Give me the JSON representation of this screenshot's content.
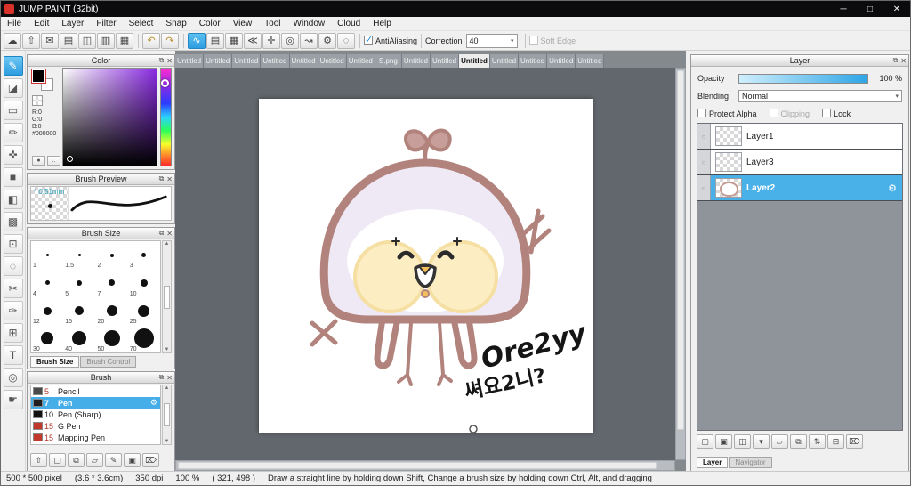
{
  "window": {
    "title": "JUMP PAINT (32bit)",
    "controls": {
      "minimize": "─",
      "maximize": "□",
      "close": "✕"
    }
  },
  "menu": {
    "items": [
      "File",
      "Edit",
      "Layer",
      "Filter",
      "Select",
      "Snap",
      "Color",
      "View",
      "Tool",
      "Window",
      "Cloud",
      "Help"
    ]
  },
  "panel_icons": {
    "popout": "⧉",
    "close": "✕",
    "gear": "⚙",
    "up": "▲",
    "down": "▼",
    "dropdown": "▾",
    "circle": "○",
    "eye": "●",
    "more": ".."
  },
  "toolbar": {
    "icons": [
      {
        "name": "cloud-icon",
        "glyph": "☁"
      },
      {
        "name": "upload-icon",
        "glyph": "⇧"
      },
      {
        "name": "comment-icon",
        "glyph": "✉"
      },
      {
        "name": "display-icon",
        "glyph": "▤"
      },
      {
        "name": "pages-icon",
        "glyph": "◫"
      },
      {
        "name": "split-view-icon",
        "glyph": "▥"
      },
      {
        "name": "material-grid-icon",
        "glyph": "▦"
      },
      {
        "sep": true
      },
      {
        "name": "undo-icon",
        "glyph": "↶",
        "gold": true
      },
      {
        "name": "redo-icon",
        "glyph": "↷",
        "gold": true
      },
      {
        "sep": true
      },
      {
        "name": "smoothing-brush-icon",
        "glyph": "∿",
        "selected": true
      },
      {
        "name": "parallel-snap-icon",
        "glyph": "▤"
      },
      {
        "name": "grid-snap-icon",
        "glyph": "▦"
      },
      {
        "name": "angle-snap-icon",
        "glyph": "≪"
      },
      {
        "name": "cross-snap-icon",
        "glyph": "✛"
      },
      {
        "name": "circle-snap-icon",
        "glyph": "◎"
      },
      {
        "name": "curve-snap-icon",
        "glyph": "↝"
      },
      {
        "name": "snap-settings-icon",
        "glyph": "⚙"
      },
      {
        "name": "snap-off-icon",
        "glyph": "◌"
      },
      {
        "sep": true
      }
    ],
    "antialiasing_label": "AntiAliasing",
    "correction_label": "Correction",
    "correction_value": "40",
    "soft_edge_label": "Soft Edge"
  },
  "tools": [
    {
      "name": "pen-tool",
      "glyph": "✎",
      "selected": true
    },
    {
      "name": "eraser-tool",
      "glyph": "◪"
    },
    {
      "name": "select-pen-tool",
      "glyph": "▭"
    },
    {
      "name": "brush-tool",
      "glyph": "✏"
    },
    {
      "name": "move-tool",
      "glyph": "✜"
    },
    {
      "name": "fill-rect-tool",
      "glyph": "■"
    },
    {
      "name": "bucket-tool",
      "glyph": "◧"
    },
    {
      "name": "gradient-tool",
      "glyph": "▩"
    },
    {
      "name": "marquee-select-tool",
      "glyph": "⊡"
    },
    {
      "name": "lasso-select-tool",
      "glyph": "◌"
    },
    {
      "name": "magic-wand-tool",
      "glyph": "✂"
    },
    {
      "name": "pen-correct-tool",
      "glyph": "✑"
    },
    {
      "name": "grid-select-tool",
      "glyph": "⊞"
    },
    {
      "name": "text-tool",
      "glyph": "T"
    },
    {
      "name": "zoom-tool",
      "glyph": "◎"
    },
    {
      "name": "hand-tool",
      "glyph": "☛"
    }
  ],
  "tabs": {
    "items": [
      {
        "label": "Untitled"
      },
      {
        "label": "Untitled"
      },
      {
        "label": "Untitled"
      },
      {
        "label": "Untitled"
      },
      {
        "label": "Untitled"
      },
      {
        "label": "Untitled"
      },
      {
        "label": "Untitled"
      },
      {
        "label": "S.png"
      },
      {
        "label": "Untitled"
      },
      {
        "label": "Untitled"
      },
      {
        "label": "Untitled",
        "active": true
      },
      {
        "label": "Untitled"
      },
      {
        "label": "Untitled"
      },
      {
        "label": "Untitled"
      },
      {
        "label": "Untitled"
      }
    ]
  },
  "color_panel": {
    "title": "Color",
    "r": "R:0",
    "g": "G:0",
    "b": "B:0",
    "hex": "#000000"
  },
  "brush_preview": {
    "title": "Brush Preview",
    "size_label": "* 0.51mm"
  },
  "brush_size": {
    "title": "Brush Size",
    "sizes": [
      1,
      1.5,
      2,
      3,
      4,
      5,
      7,
      10,
      12,
      15,
      20,
      25,
      30,
      40,
      50,
      70
    ],
    "tabs": [
      {
        "label": "Brush Size",
        "active": true
      },
      {
        "label": "Brush Control"
      }
    ]
  },
  "brush_panel": {
    "title": "Brush",
    "items": [
      {
        "size": "5",
        "name": "Pencil",
        "swatch": "#4a4a4a",
        "size_color": "#b03a2e"
      },
      {
        "size": "7",
        "name": "Pen",
        "swatch": "#1d1d1d",
        "selected": true
      },
      {
        "size": "10",
        "name": "Pen (Sharp)",
        "swatch": "#111111",
        "size_color": "#222222"
      },
      {
        "size": "15",
        "name": "G Pen",
        "swatch": "#c0392b",
        "size_color": "#b03a2e"
      },
      {
        "size": "15",
        "name": "Mapping Pen",
        "swatch": "#c0392b",
        "size_color": "#b03a2e"
      }
    ],
    "footer_icons": [
      {
        "name": "dock-up-icon",
        "glyph": "⇧"
      },
      {
        "name": "new-brush-icon",
        "glyph": "▢"
      },
      {
        "name": "duplicate-brush-icon",
        "glyph": "⧉"
      },
      {
        "name": "brush-folder-icon",
        "glyph": "▱"
      },
      {
        "name": "edit-brush-icon",
        "glyph": "✎"
      },
      {
        "name": "save-brush-icon",
        "glyph": "▣"
      },
      {
        "name": "delete-brush-icon",
        "glyph": "⌦"
      }
    ]
  },
  "layer_panel": {
    "title": "Layer",
    "opacity_label": "Opacity",
    "opacity_value": "100 %",
    "blending_label": "Blending",
    "blending_value": "Normal",
    "protect_alpha_label": "Protect Alpha",
    "clipping_label": "Clipping",
    "lock_label": "Lock",
    "layers": [
      {
        "name": "Layer1"
      },
      {
        "name": "Layer3"
      },
      {
        "name": "Layer2",
        "selected": true,
        "art": true
      }
    ],
    "footer_icons": [
      {
        "name": "add-layer-icon",
        "glyph": "▢"
      },
      {
        "name": "add-pixel-layer-icon",
        "glyph": "▣"
      },
      {
        "name": "add-1bit-layer-icon",
        "glyph": "◫"
      },
      {
        "name": "layer-menu-arrow-icon",
        "glyph": "▾"
      },
      {
        "name": "add-folder-icon",
        "glyph": "▱"
      },
      {
        "name": "duplicate-layer-icon",
        "glyph": "⧉"
      },
      {
        "name": "transfer-layer-icon",
        "glyph": "⇅"
      },
      {
        "name": "merge-layer-icon",
        "glyph": "⊟"
      },
      {
        "name": "delete-layer-icon",
        "glyph": "⌦"
      }
    ],
    "tabs": [
      {
        "label": "Layer",
        "active": true
      },
      {
        "label": "Navigator"
      }
    ]
  },
  "canvas": {
    "signature_line1": "Ore2yy",
    "signature_line2": "쎠요2니?"
  },
  "status": {
    "size": "500 * 500 pixel",
    "dimensions": "(3.6 * 3.6cm)",
    "dpi": "350 dpi",
    "zoom": "100 %",
    "coords": "( 321, 498 )",
    "hint": "Draw a straight line by holding down Shift, Change a brush size by holding down Ctrl, Alt, and dragging"
  }
}
